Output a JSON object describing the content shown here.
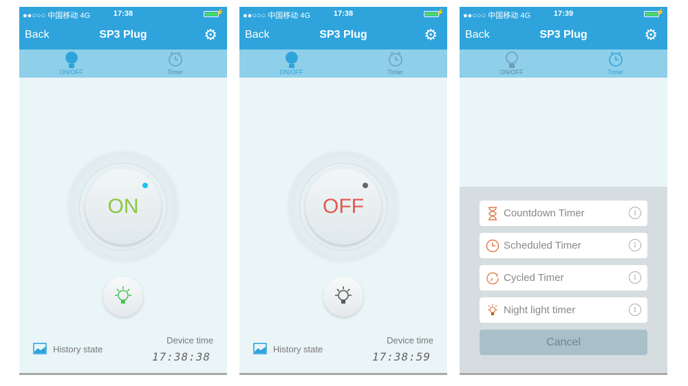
{
  "colors": {
    "accent": "#2ea3dc",
    "on": "#8cc63f",
    "off": "#e05a4f",
    "timer_icon": "#e07a4a"
  },
  "screens": [
    {
      "status": {
        "carrier": "●●○○○ 中国移动  4G",
        "time": "17:38"
      },
      "nav": {
        "back": "Back",
        "title": "SP3 Plug",
        "settings_icon": "gear-icon"
      },
      "tabs": [
        {
          "label": "ON/OFF",
          "active": true
        },
        {
          "label": "Timer",
          "active": false
        }
      ],
      "power": {
        "state": "ON",
        "indicator": "#1fc4ee"
      },
      "history": "History state",
      "device_time_label": "Device time",
      "device_time": "17:38:38"
    },
    {
      "status": {
        "carrier": "●●○○○ 中国移动  4G",
        "time": "17:38"
      },
      "nav": {
        "back": "Back",
        "title": "SP3 Plug",
        "settings_icon": "gear-icon"
      },
      "tabs": [
        {
          "label": "ON/OFF",
          "active": true
        },
        {
          "label": "Timer",
          "active": false
        }
      ],
      "power": {
        "state": "OFF",
        "indicator": "#666666"
      },
      "history": "History state",
      "device_time_label": "Device time",
      "device_time": "17:38:59"
    },
    {
      "status": {
        "carrier": "●●○○○ 中国移动  4G",
        "time": "17:39"
      },
      "nav": {
        "back": "Back",
        "title": "SP3 Plug",
        "settings_icon": "gear-icon"
      },
      "tabs": [
        {
          "label": "ON/OFF",
          "active": false
        },
        {
          "label": "Timer",
          "active": true
        }
      ],
      "timer_menu": {
        "items": [
          {
            "label": "Countdown Timer",
            "icon": "hourglass-icon"
          },
          {
            "label": "Scheduled Timer",
            "icon": "clock-icon"
          },
          {
            "label": "Cycled Timer",
            "icon": "cycle-icon"
          },
          {
            "label": "Night light timer",
            "icon": "bulb-icon"
          }
        ],
        "info_glyph": "i",
        "cancel": "Cancel"
      }
    }
  ]
}
